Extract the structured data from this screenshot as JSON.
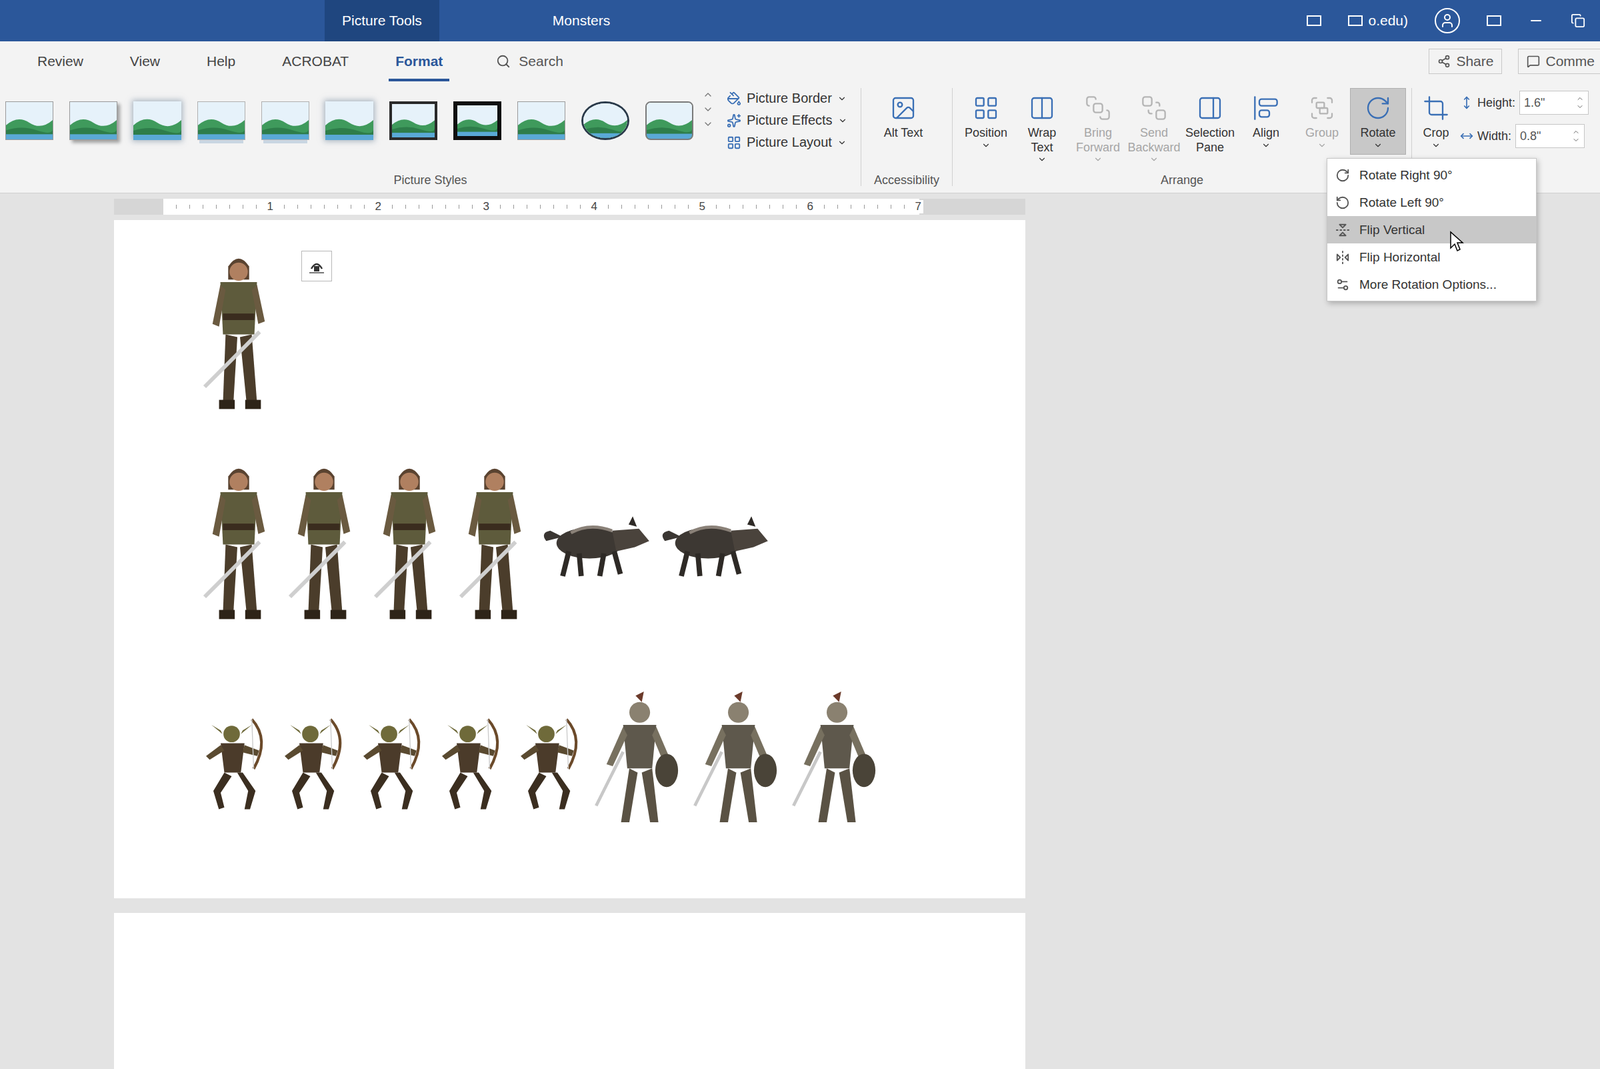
{
  "window": {
    "context_tab": "Picture Tools",
    "title": "Monsters",
    "account": "o.edu)"
  },
  "ribbon_tabs": [
    {
      "label": "Review",
      "selected": false
    },
    {
      "label": "View",
      "selected": false
    },
    {
      "label": "Help",
      "selected": false
    },
    {
      "label": "ACROBAT",
      "selected": false
    },
    {
      "label": "Format",
      "selected": true
    }
  ],
  "search": {
    "placeholder": "Search"
  },
  "share": {
    "label": "Share"
  },
  "comments": {
    "label": "Comme"
  },
  "picture_styles": {
    "label": "Picture Styles",
    "styles": [
      {
        "kind": "plain"
      },
      {
        "kind": "shadow"
      },
      {
        "kind": "soft"
      },
      {
        "kind": "reflected"
      },
      {
        "kind": "reflected"
      },
      {
        "kind": "soft"
      },
      {
        "kind": "thin-frame"
      },
      {
        "kind": "black-frame"
      },
      {
        "kind": "plain"
      },
      {
        "kind": "oval"
      },
      {
        "kind": "rounded"
      }
    ],
    "commands": [
      {
        "label": "Picture Border"
      },
      {
        "label": "Picture Effects"
      },
      {
        "label": "Picture Layout"
      }
    ]
  },
  "accessibility": {
    "label": "Accessibility",
    "buttons": [
      {
        "label": "Alt Text",
        "disabled": false,
        "pressed": false,
        "dropdown": false
      }
    ]
  },
  "arrange": {
    "label": "Arrange",
    "buttons": [
      {
        "label": "Position",
        "disabled": false,
        "pressed": false,
        "dropdown": true
      },
      {
        "label": "Wrap Text",
        "disabled": false,
        "pressed": false,
        "dropdown": true
      },
      {
        "label": "Bring Forward",
        "disabled": true,
        "pressed": false,
        "dropdown": true
      },
      {
        "label": "Send Backward",
        "disabled": true,
        "pressed": false,
        "dropdown": true
      },
      {
        "label": "Selection Pane",
        "disabled": false,
        "pressed": false,
        "dropdown": false
      },
      {
        "label": "Align",
        "disabled": false,
        "pressed": false,
        "dropdown": true
      },
      {
        "label": "Group",
        "disabled": true,
        "pressed": false,
        "dropdown": true
      },
      {
        "label": "Rotate",
        "disabled": false,
        "pressed": true,
        "dropdown": true
      }
    ]
  },
  "size": {
    "crop": {
      "label": "Crop",
      "dropdown": true
    },
    "height": {
      "label": "Height:",
      "value": "1.6\""
    },
    "width": {
      "label": "Width:",
      "value": "0.8\""
    }
  },
  "ruler": {
    "ticks": [
      "1",
      "2",
      "3",
      "4",
      "5",
      "6",
      "7"
    ]
  },
  "document": {
    "rows": [
      {
        "pictures": [
          {
            "kind": "warrior"
          }
        ]
      },
      {
        "pictures": [
          {
            "kind": "warrior"
          },
          {
            "kind": "warrior"
          },
          {
            "kind": "warrior"
          },
          {
            "kind": "warrior"
          },
          {
            "kind": "wolf"
          },
          {
            "kind": "wolf"
          }
        ]
      },
      {
        "pictures": [
          {
            "kind": "goblin"
          },
          {
            "kind": "goblin"
          },
          {
            "kind": "goblin"
          },
          {
            "kind": "goblin"
          },
          {
            "kind": "goblin"
          },
          {
            "kind": "skeleton"
          },
          {
            "kind": "skeleton"
          },
          {
            "kind": "skeleton"
          }
        ]
      }
    ]
  },
  "rotate_menu": {
    "items": [
      {
        "label": "Rotate Right 90°",
        "selected": false
      },
      {
        "label": "Rotate Left 90°",
        "selected": false
      },
      {
        "label": "Flip Vertical",
        "selected": true
      },
      {
        "label": "Flip Horizontal",
        "selected": false
      },
      {
        "label": "More Rotation Options...",
        "selected": false
      }
    ]
  }
}
